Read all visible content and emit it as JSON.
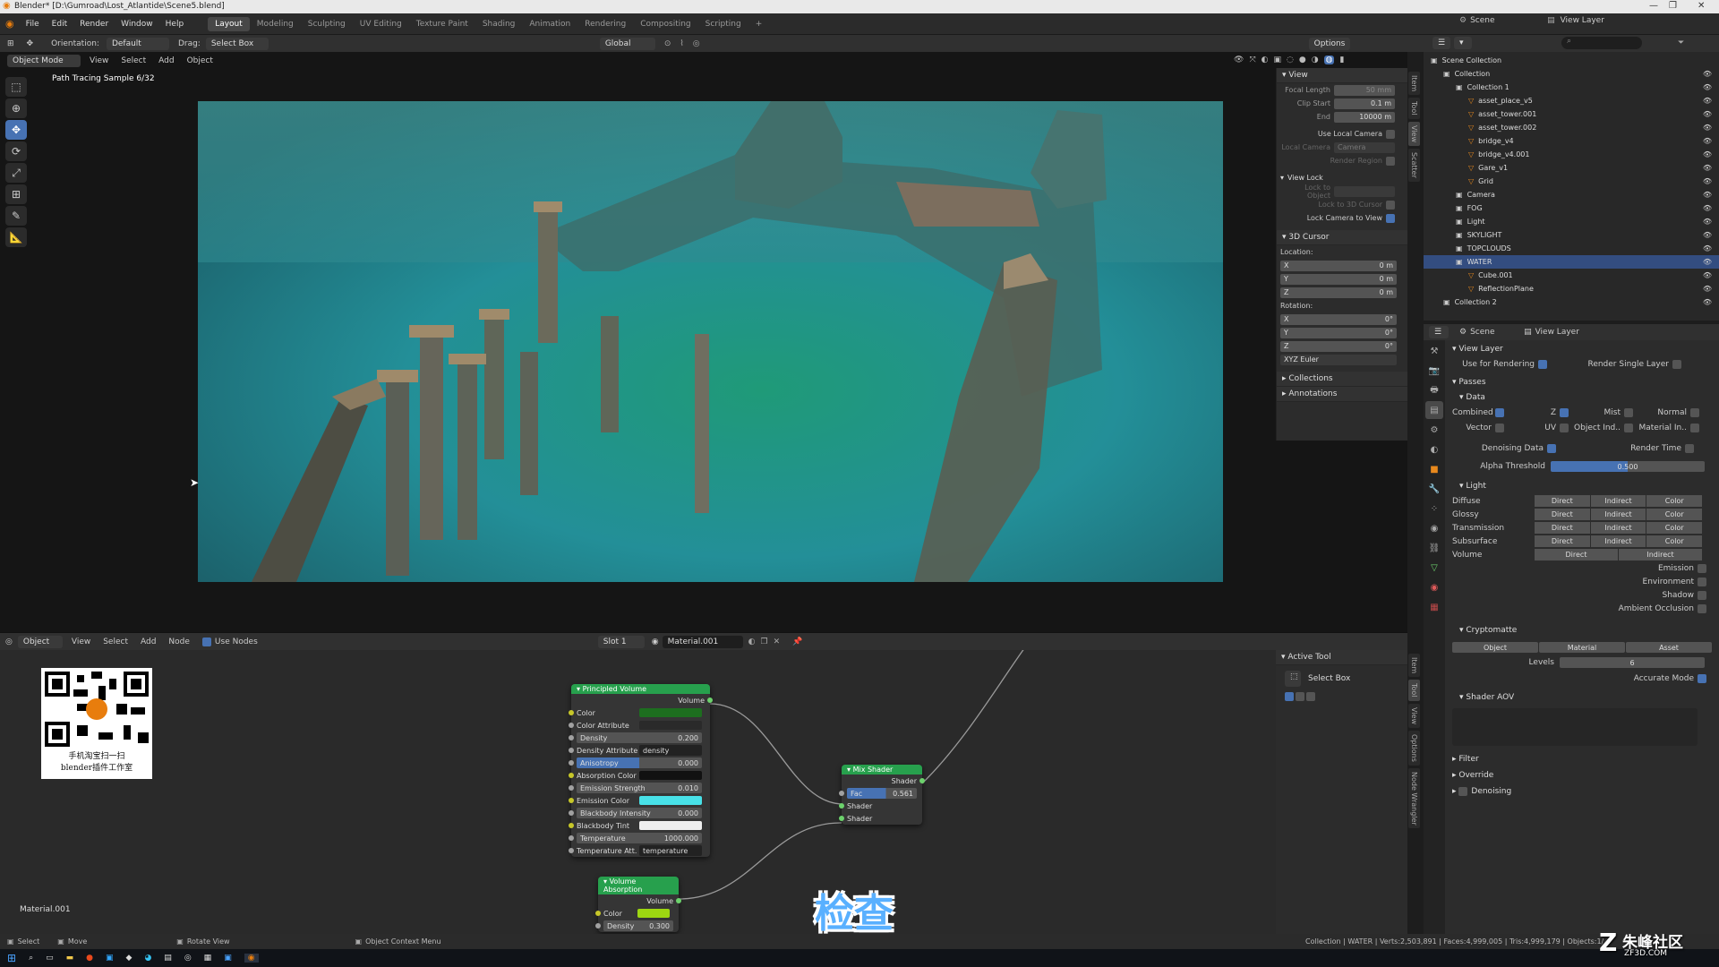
{
  "window": {
    "title": "Blender* [D:\\Gumroad\\Lost_Atlantide\\Scene5.blend]"
  },
  "menu": [
    "File",
    "Edit",
    "Render",
    "Window",
    "Help"
  ],
  "workspaces": [
    "Layout",
    "Modeling",
    "Sculpting",
    "UV Editing",
    "Texture Paint",
    "Shading",
    "Animation",
    "Rendering",
    "Compositing",
    "Scripting"
  ],
  "header_right": {
    "scene": "Scene",
    "view_layer": "View Layer"
  },
  "toolheader": {
    "orientation_label": "Orientation:",
    "orientation": "Default",
    "drag_label": "Drag:",
    "drag": "Select Box",
    "transform": "Global",
    "options": "Options"
  },
  "viewport_header": {
    "mode": "Object Mode",
    "items": [
      "View",
      "Select",
      "Add",
      "Object"
    ]
  },
  "viewport": {
    "sample_text": "Path Tracing Sample 6/32"
  },
  "npanel": {
    "view_title": "View",
    "focal_length_label": "Focal Length",
    "focal_length": "50 mm",
    "clip_start_label": "Clip Start",
    "clip_start": "0.1 m",
    "end_label": "End",
    "end": "10000 m",
    "use_local_camera": "Use Local Camera",
    "local_camera_label": "Local Camera",
    "local_camera": "Camera",
    "render_region": "Render Region",
    "view_lock_title": "View Lock",
    "lock_to_object": "Lock to Object",
    "lock_to_3d_cursor": "Lock to 3D Cursor",
    "lock_camera_to_view": "Lock Camera to View",
    "cursor_title": "3D Cursor",
    "location_label": "Location:",
    "loc_x": "0 m",
    "loc_y": "0 m",
    "loc_z": "0 m",
    "rotation_label": "Rotation:",
    "rot_x": "0°",
    "rot_y": "0°",
    "rot_z": "0°",
    "euler": "XYZ Euler",
    "collections": "Collections",
    "annotations": "Annotations",
    "tabs": [
      "Item",
      "Tool",
      "View",
      "Scatter"
    ]
  },
  "node_header": {
    "editor": "Object",
    "items": [
      "View",
      "Select",
      "Add",
      "Node"
    ],
    "use_nodes": "Use Nodes",
    "slot": "Slot 1",
    "material": "Material.001"
  },
  "node_sidebar": {
    "title": "Active Tool",
    "tool": "Select Box",
    "tabs": [
      "Item",
      "Tool",
      "View",
      "Options",
      "Node Wrangler"
    ]
  },
  "nodes": {
    "principled": {
      "title": "Principled Volume",
      "out": "Volume",
      "rows": [
        {
          "label": "Color",
          "value": ""
        },
        {
          "label": "Color Attribute",
          "value": ""
        },
        {
          "label": "Density",
          "value": "0.200"
        },
        {
          "label": "Density Attribute",
          "value": "density"
        },
        {
          "label": "Anisotropy",
          "value": "0.000"
        },
        {
          "label": "Absorption Color",
          "value": ""
        },
        {
          "label": "Emission Strength",
          "value": "0.010"
        },
        {
          "label": "Emission Color",
          "value": ""
        },
        {
          "label": "Blackbody Intensity",
          "value": "0.000"
        },
        {
          "label": "Blackbody Tint",
          "value": ""
        },
        {
          "label": "Temperature",
          "value": "1000.000"
        },
        {
          "label": "Temperature Att.",
          "value": "temperature"
        }
      ]
    },
    "mix": {
      "title": "Mix Shader",
      "out": "Shader",
      "fac_label": "Fac",
      "fac": "0.561",
      "in1": "Shader",
      "in2": "Shader"
    },
    "absorption": {
      "title": "Volume Absorption",
      "out": "Volume",
      "color": "Color",
      "density_label": "Density",
      "density": "0.300"
    }
  },
  "overlay": {
    "qr_caption_1": "手机淘宝扫一扫",
    "qr_caption_2": "blender插件工作室",
    "material_label": "Material.001",
    "check_text": "检查",
    "watermark": "朱峰社区",
    "watermark_sub": "ZF3D.COM"
  },
  "outliner": {
    "items": [
      {
        "label": "Scene Collection",
        "indent": 0
      },
      {
        "label": "Collection",
        "indent": 1
      },
      {
        "label": "Collection 1",
        "indent": 2
      },
      {
        "label": "asset_place_v5",
        "indent": 3
      },
      {
        "label": "asset_tower.001",
        "indent": 3
      },
      {
        "label": "asset_tower.002",
        "indent": 3
      },
      {
        "label": "bridge_v4",
        "indent": 3
      },
      {
        "label": "bridge_v4.001",
        "indent": 3
      },
      {
        "label": "Gare_v1",
        "indent": 3
      },
      {
        "label": "Grid",
        "indent": 3
      },
      {
        "label": "Camera",
        "indent": 2
      },
      {
        "label": "FOG",
        "indent": 2
      },
      {
        "label": "Light",
        "indent": 2
      },
      {
        "label": "SKYLIGHT",
        "indent": 2
      },
      {
        "label": "TOPCLOUDS",
        "indent": 2
      },
      {
        "label": "WATER",
        "indent": 2
      },
      {
        "label": "Cube.001",
        "indent": 3
      },
      {
        "label": "ReflectionPlane",
        "indent": 3
      },
      {
        "label": "Collection 2",
        "indent": 1
      }
    ],
    "selected": "WATER"
  },
  "properties": {
    "scene": "Scene",
    "view_layer": "View Layer",
    "view_layer_title": "View Layer",
    "use_for_rendering": "Use for Rendering",
    "render_single_layer": "Render Single Layer",
    "passes": "Passes",
    "data": "Data",
    "combined": "Combined",
    "z": "Z",
    "mist": "Mist",
    "normal": "Normal",
    "vector": "Vector",
    "uv": "UV",
    "object_index": "Object Ind..",
    "material_index": "Material In..",
    "denoising_data": "Denoising Data",
    "render_time": "Render Time",
    "alpha_threshold_label": "Alpha Threshold",
    "alpha_threshold": "0.500",
    "light": "Light",
    "light_rows": [
      {
        "label": "Diffuse",
        "btns": [
          "Direct",
          "Indirect",
          "Color"
        ]
      },
      {
        "label": "Glossy",
        "btns": [
          "Direct",
          "Indirect",
          "Color"
        ]
      },
      {
        "label": "Transmission",
        "btns": [
          "Direct",
          "Indirect",
          "Color"
        ]
      },
      {
        "label": "Subsurface",
        "btns": [
          "Direct",
          "Indirect",
          "Color"
        ]
      },
      {
        "label": "Volume",
        "btns": [
          "Direct",
          "Indirect"
        ]
      }
    ],
    "emission": "Emission",
    "environment": "Environment",
    "shadow": "Shadow",
    "ao": "Ambient Occlusion",
    "cryptomatte": "Cryptomatte",
    "crypto_btns": [
      "Object",
      "Material",
      "Asset"
    ],
    "levels_label": "Levels",
    "levels": "6",
    "accurate_mode": "Accurate Mode",
    "shader_aov": "Shader AOV",
    "filter": "Filter",
    "override": "Override",
    "denoising": "Denoising"
  },
  "status": {
    "select": "Select",
    "move": "Move",
    "rotate_view": "Rotate View",
    "context_menu": "Object Context Menu",
    "stats": "Collection | WATER | Verts:2,503,891 | Faces:4,999,005 | Tris:4,999,179 | Objects:1/..."
  },
  "colors": {
    "accent": "#4772b3",
    "node_green": "#27a04d",
    "water": "#2f9c9d"
  }
}
